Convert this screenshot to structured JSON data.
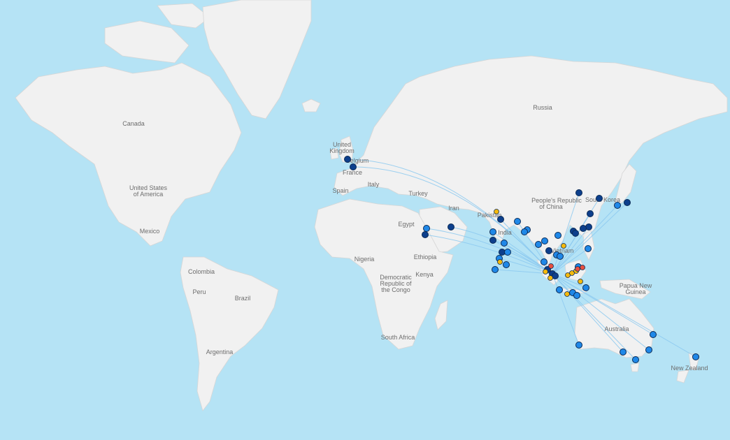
{
  "map": {
    "colors": {
      "water": "#b5e3f5",
      "land": "#f1f1f1",
      "border": "#d6d6d6",
      "route": "#8cc9f0",
      "marker_dark": "#0d3f8c",
      "marker_mid": "#1f88e8",
      "marker_yellow": "#f5b90c",
      "marker_red": "#e8503f"
    },
    "labels": [
      {
        "id": "canada",
        "text": "Canada"
      },
      {
        "id": "usa1",
        "text": "United States"
      },
      {
        "id": "usa2",
        "text": "of America"
      },
      {
        "id": "mexico",
        "text": "Mexico"
      },
      {
        "id": "colombia",
        "text": "Colombia"
      },
      {
        "id": "peru",
        "text": "Peru"
      },
      {
        "id": "brazil",
        "text": "Brazil"
      },
      {
        "id": "argentina",
        "text": "Argentina"
      },
      {
        "id": "uk1",
        "text": "United"
      },
      {
        "id": "uk2",
        "text": "Kingdom"
      },
      {
        "id": "belgium",
        "text": "Belgium"
      },
      {
        "id": "france",
        "text": "France"
      },
      {
        "id": "spain",
        "text": "Spain"
      },
      {
        "id": "italy",
        "text": "Italy"
      },
      {
        "id": "turkey",
        "text": "Turkey"
      },
      {
        "id": "iran",
        "text": "Iran"
      },
      {
        "id": "pakistan",
        "text": "Pakistan"
      },
      {
        "id": "egypt",
        "text": "Egypt"
      },
      {
        "id": "nigeria",
        "text": "Nigeria"
      },
      {
        "id": "ethiopia",
        "text": "Ethiopia"
      },
      {
        "id": "kenya",
        "text": "Kenya"
      },
      {
        "id": "drc1",
        "text": "Democratic"
      },
      {
        "id": "drc2",
        "text": "Republic of"
      },
      {
        "id": "drc3",
        "text": "the Congo"
      },
      {
        "id": "southafrica",
        "text": "South Africa"
      },
      {
        "id": "russia",
        "text": "Russia"
      },
      {
        "id": "china1",
        "text": "People's Republic"
      },
      {
        "id": "china2",
        "text": "of China"
      },
      {
        "id": "korea",
        "text": "South Korea"
      },
      {
        "id": "india",
        "text": "India"
      },
      {
        "id": "vietnam",
        "text": "Vietnam"
      },
      {
        "id": "png1",
        "text": "Papua New"
      },
      {
        "id": "png2",
        "text": "Guinea"
      },
      {
        "id": "australia",
        "text": "Australia"
      },
      {
        "id": "nz",
        "text": "New Zealand"
      }
    ]
  }
}
